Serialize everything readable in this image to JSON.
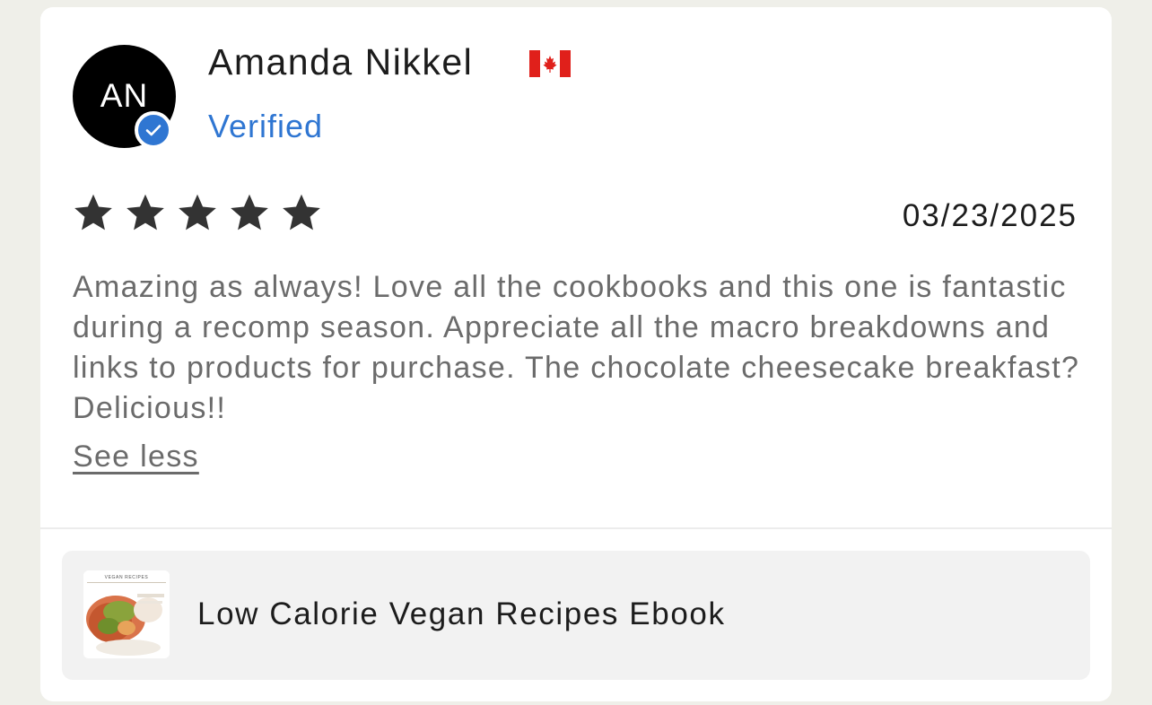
{
  "reviewer": {
    "initials": "AN",
    "name": "Amanda Nikkel",
    "country_flag_icon": "canada-flag-icon",
    "verified_label": "Verified"
  },
  "rating": {
    "stars": 5,
    "max": 5
  },
  "date": "03/23/2025",
  "review": {
    "text": "Amazing as always! Love all the cookbooks and this one is fantastic during a recomp season. Appreciate all the macro breakdowns and links to products for purchase. The chocolate cheesecake breakfast? Delicious!!",
    "toggle_label": "See less"
  },
  "product": {
    "title": "Low Calorie Vegan Recipes Ebook",
    "thumbnail_caption": "VEGAN RECIPES"
  },
  "colors": {
    "accent": "#2f76d2",
    "star": "#333333",
    "flag_red": "#e0201b",
    "page_background": "#efefe9"
  }
}
